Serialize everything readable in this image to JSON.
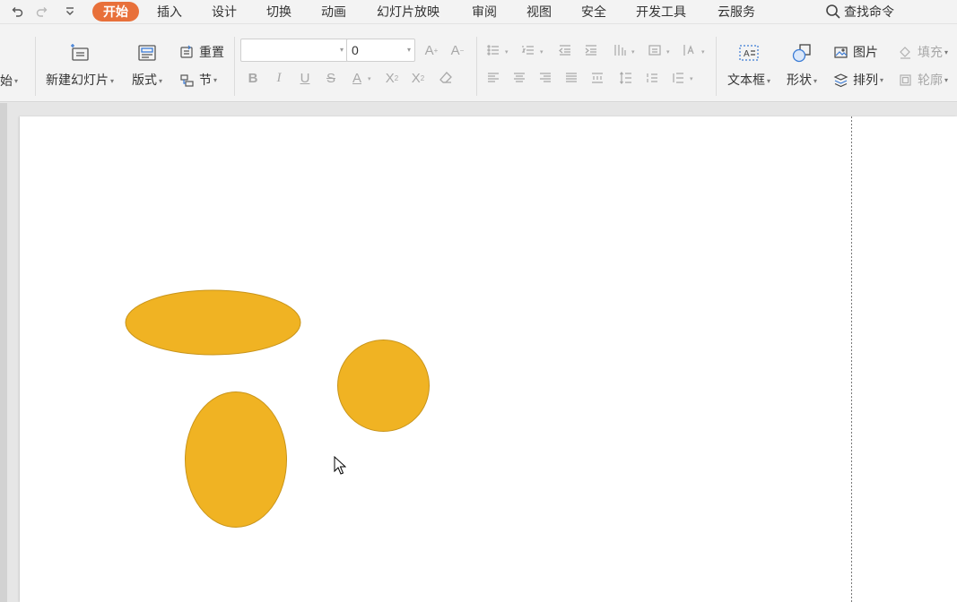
{
  "menubar": {
    "tabs": [
      "开始",
      "插入",
      "设计",
      "切换",
      "动画",
      "幻灯片放映",
      "审阅",
      "视图",
      "安全",
      "开发工具",
      "云服务"
    ],
    "active_tab": "开始",
    "search_label": "查找命令"
  },
  "ribbon": {
    "partial_label": "始",
    "new_slide": "新建幻灯片",
    "layout": "版式",
    "reset": "重置",
    "section": "节",
    "font_name": "",
    "font_size": "0",
    "text_box": "文本框",
    "shape": "形状",
    "picture": "图片",
    "arrange": "排列",
    "fill": "填充",
    "outline": "轮廓"
  },
  "slide": {
    "shape_fill": "#F0B323",
    "shape_stroke": "#C8941A",
    "shapes": [
      "ellipse",
      "circle",
      "ellipse"
    ]
  },
  "colors": {
    "accent": "#E8703A",
    "ribbon_bg": "#F3F3F3"
  }
}
